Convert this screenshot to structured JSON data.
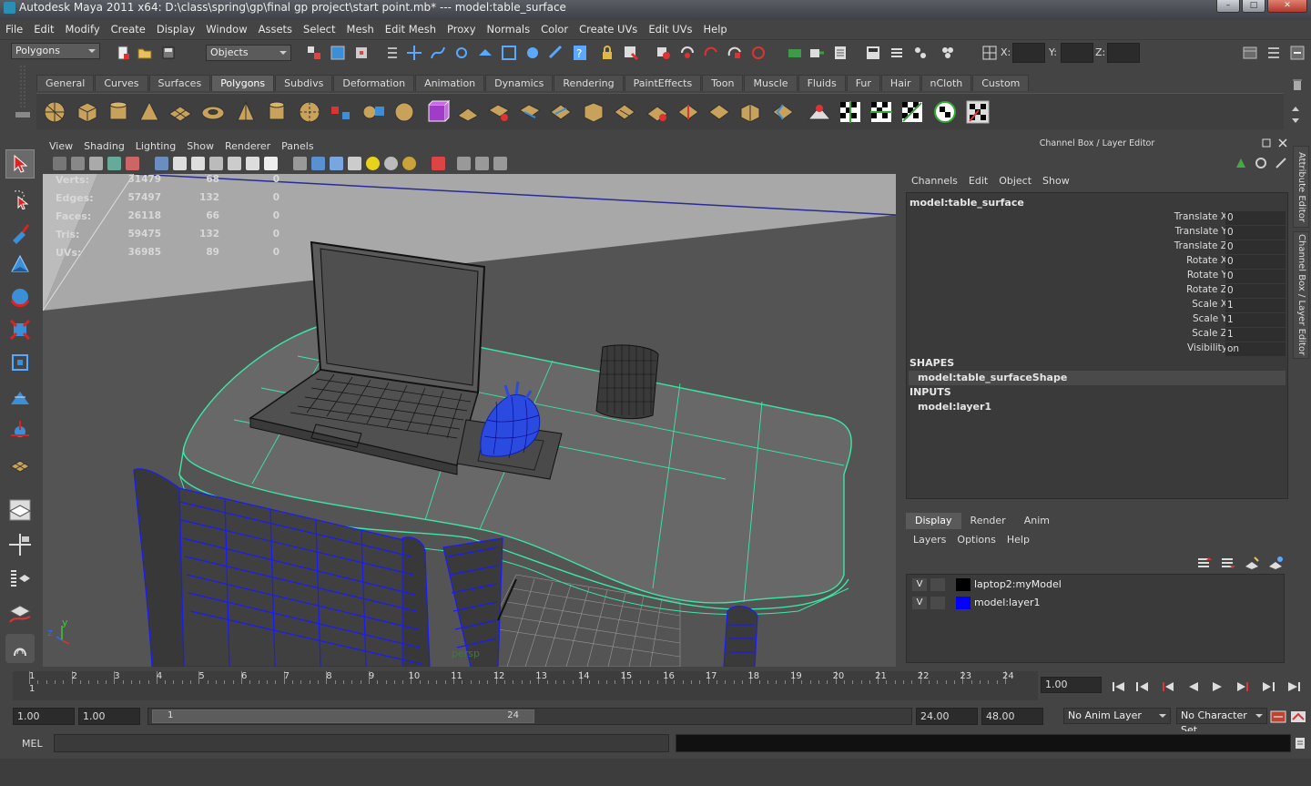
{
  "window": {
    "title": "Autodesk Maya 2011 x64: D:\\class\\spring\\gp\\final gp project\\start point.mb*   ---   model:table_surface",
    "min": "–",
    "max": "□",
    "close": "✕"
  },
  "menubar": [
    "File",
    "Edit",
    "Modify",
    "Create",
    "Display",
    "Window",
    "Assets",
    "Select",
    "Mesh",
    "Edit Mesh",
    "Proxy",
    "Normals",
    "Color",
    "Create UVs",
    "Edit UVs",
    "Help"
  ],
  "statusline": {
    "menuset": "Polygons",
    "selection_mode": "Objects",
    "x_label": "X:",
    "y_label": "Y:",
    "z_label": "Z:"
  },
  "shelf": {
    "tabs": [
      "General",
      "Curves",
      "Surfaces",
      "Polygons",
      "Subdivs",
      "Deformation",
      "Animation",
      "Dynamics",
      "Rendering",
      "PaintEffects",
      "Toon",
      "Muscle",
      "Fluids",
      "Fur",
      "Hair",
      "nCloth",
      "Custom"
    ],
    "active": "Polygons"
  },
  "viewport": {
    "menu": [
      "View",
      "Shading",
      "Lighting",
      "Show",
      "Renderer",
      "Panels"
    ],
    "camera": "persp",
    "hud": [
      {
        "label": "Verts:",
        "v1": "31479",
        "v2": "68",
        "v3": "0"
      },
      {
        "label": "Edges:",
        "v1": "57497",
        "v2": "132",
        "v3": "0"
      },
      {
        "label": "Faces:",
        "v1": "26118",
        "v2": "66",
        "v3": "0"
      },
      {
        "label": "Tris:",
        "v1": "59475",
        "v2": "132",
        "v3": "0"
      },
      {
        "label": "UVs:",
        "v1": "36985",
        "v2": "89",
        "v3": "0"
      }
    ],
    "axis_z": "z",
    "axis_y": "y"
  },
  "channelbox": {
    "title": "Channel Box / Layer Editor",
    "menu": [
      "Channels",
      "Edit",
      "Object",
      "Show"
    ],
    "object": "model:table_surface",
    "attributes": [
      {
        "name": "Translate X",
        "value": "0"
      },
      {
        "name": "Translate Y",
        "value": "0"
      },
      {
        "name": "Translate Z",
        "value": "0"
      },
      {
        "name": "Rotate X",
        "value": "0"
      },
      {
        "name": "Rotate Y",
        "value": "0"
      },
      {
        "name": "Rotate Z",
        "value": "0"
      },
      {
        "name": "Scale X",
        "value": "1"
      },
      {
        "name": "Scale Y",
        "value": "1"
      },
      {
        "name": "Scale Z",
        "value": "1"
      },
      {
        "name": "Visibility",
        "value": "on"
      }
    ],
    "shapes_label": "SHAPES",
    "shape": "model:table_surfaceShape",
    "inputs_label": "INPUTS",
    "input": "model:layer1"
  },
  "side_tabs": {
    "attribute_editor": "Attribute Editor",
    "channel_box": "Channel Box / Layer Editor"
  },
  "layers": {
    "tabs": [
      "Display",
      "Render",
      "Anim"
    ],
    "active_tab": "Display",
    "menu": [
      "Layers",
      "Options",
      "Help"
    ],
    "items": [
      {
        "visible": "V",
        "name": "laptop2:myModel",
        "color": "#000000"
      },
      {
        "visible": "V",
        "name": "model:layer1",
        "color": "#0000ff"
      }
    ]
  },
  "timeline": {
    "frames": [
      "1",
      "2",
      "3",
      "4",
      "5",
      "6",
      "7",
      "8",
      "9",
      "10",
      "11",
      "12",
      "13",
      "14",
      "15",
      "16",
      "17",
      "18",
      "19",
      "20",
      "21",
      "22",
      "23",
      "24"
    ],
    "current_marker": "1",
    "current_time": "1.00"
  },
  "range": {
    "start_time": "1.00",
    "start_range": "1.00",
    "slider_start": "1",
    "slider_end": "24",
    "end_range": "24.00",
    "end_time": "48.00",
    "anim_layer": "No Anim Layer",
    "character_set": "No Character Set"
  },
  "command": {
    "label": "MEL"
  }
}
